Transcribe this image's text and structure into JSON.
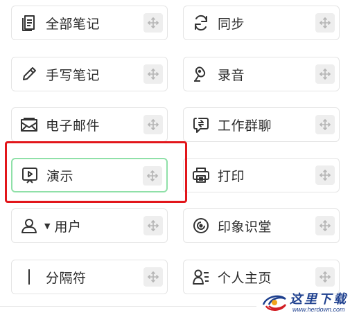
{
  "items": [
    {
      "key": "all-notes",
      "label": "全部笔记",
      "icon": "notes-icon"
    },
    {
      "key": "sync",
      "label": "同步",
      "icon": "sync-icon"
    },
    {
      "key": "handwriting",
      "label": "手写笔记",
      "icon": "pen-icon"
    },
    {
      "key": "recording",
      "label": "录音",
      "icon": "microphone-icon"
    },
    {
      "key": "email",
      "label": "电子邮件",
      "icon": "mail-icon"
    },
    {
      "key": "work-chat",
      "label": "工作群聊",
      "icon": "chat-icon"
    },
    {
      "key": "presentation",
      "label": "演示",
      "icon": "presentation-icon"
    },
    {
      "key": "print",
      "label": "打印",
      "icon": "printer-icon"
    },
    {
      "key": "user",
      "label": "用户",
      "icon": "user-icon",
      "caret": "▼"
    },
    {
      "key": "evernote-chamber",
      "label": "印象识堂",
      "icon": "target-icon"
    },
    {
      "key": "separator",
      "label": "分隔符",
      "icon": "separator-icon"
    },
    {
      "key": "profile",
      "label": "个人主页",
      "icon": "profile-icon"
    }
  ],
  "drag_handle_icon": "move-arrows-icon",
  "highlighted_item": "presentation",
  "colors": {
    "highlight_border": "#e2161b",
    "active_tile_border": "#8fe0a8",
    "watermark": "#1d3f8e"
  },
  "watermark": {
    "title": "这里下载",
    "url": "www.herdown.com"
  }
}
